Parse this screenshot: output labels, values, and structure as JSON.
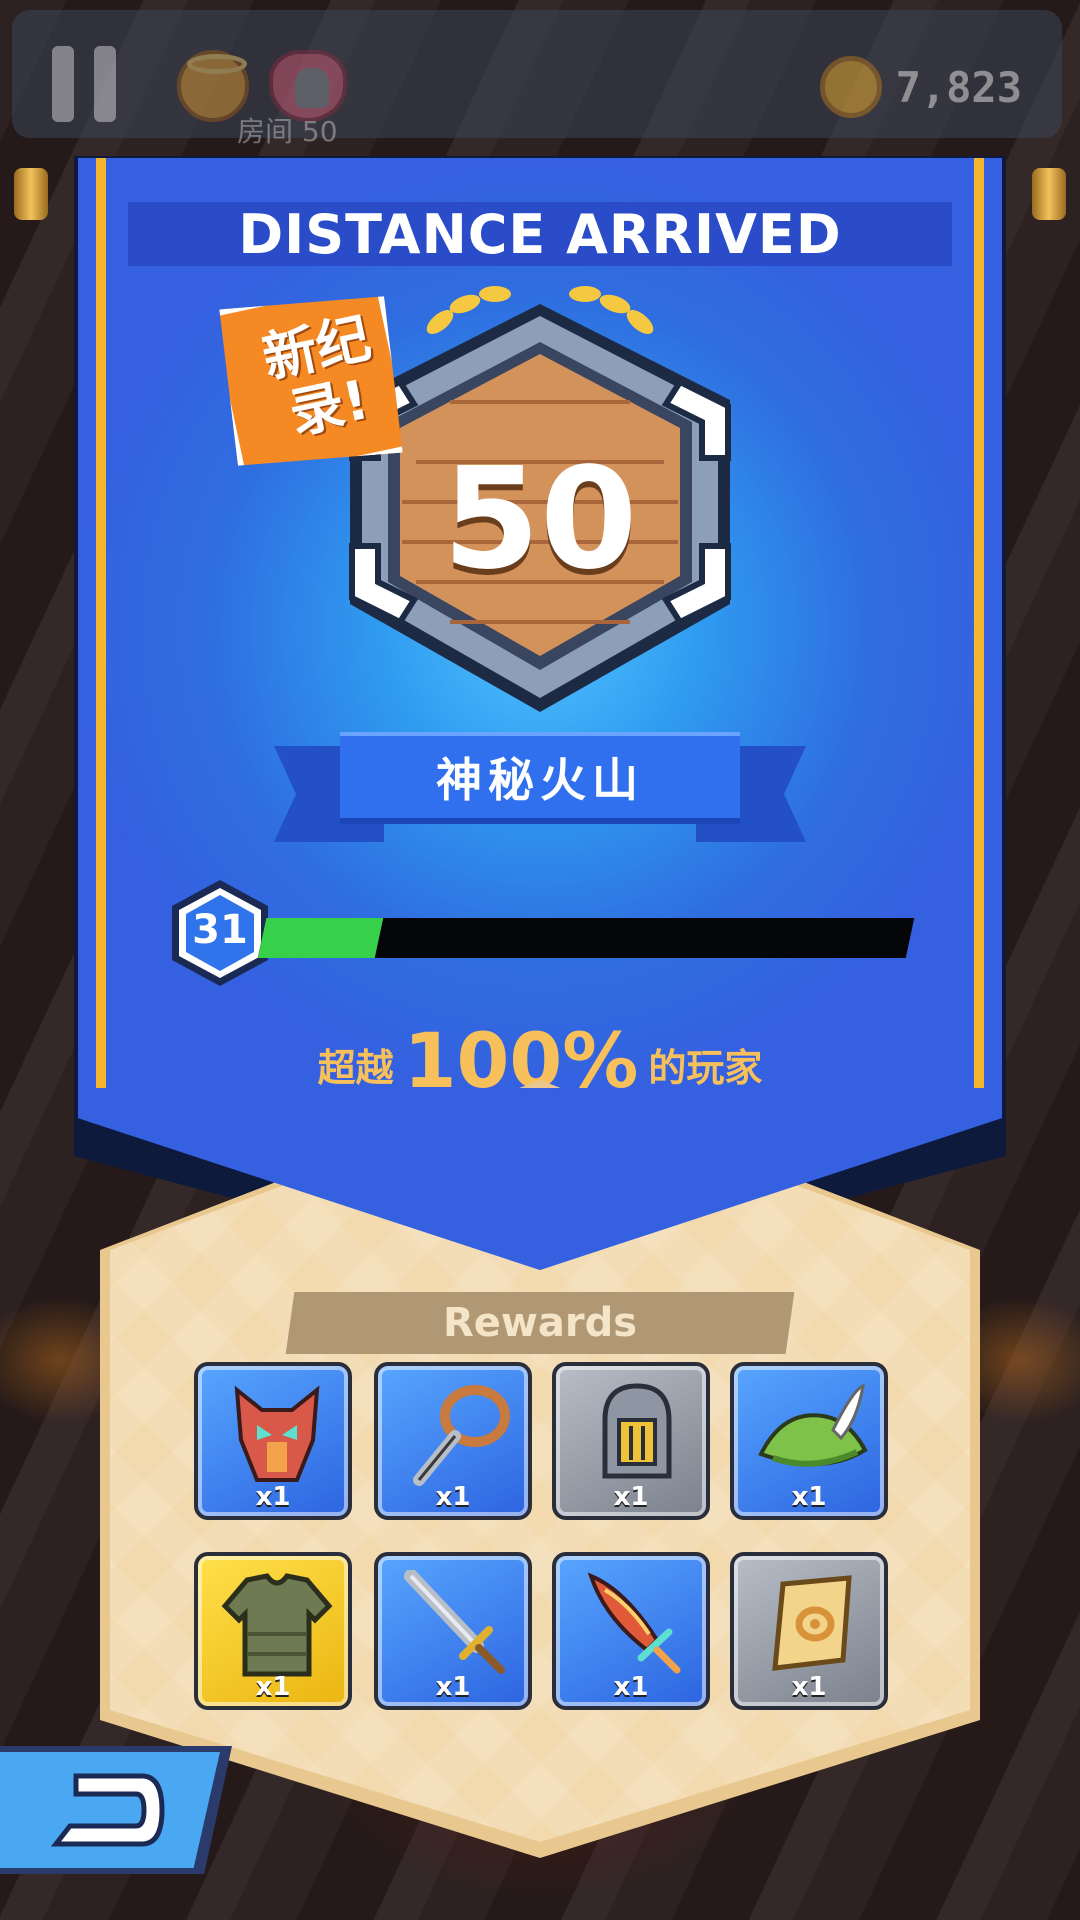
{
  "hud": {
    "party_label": "房间 50",
    "coins": "7,823"
  },
  "banner": {
    "title": "DISTANCE ARRIVED",
    "record_badge": "新纪录!",
    "distance": "50",
    "zone_name": "神秘火山",
    "level": "31",
    "level_progress": 0.18,
    "rank_prefix": "超越",
    "rank_percent": "100%",
    "rank_suffix": "的玩家"
  },
  "rewards": {
    "heading": "Rewards",
    "items": [
      {
        "icon": "dragon-mask-icon",
        "qty": "x1",
        "bg": "blue"
      },
      {
        "icon": "slingshot-icon",
        "qty": "x1",
        "bg": "blue"
      },
      {
        "icon": "knight-helmet-icon",
        "qty": "x1",
        "bg": "gray"
      },
      {
        "icon": "feather-hat-icon",
        "qty": "x1",
        "bg": "blue"
      },
      {
        "icon": "chest-armor-icon",
        "qty": "x1",
        "bg": "gold"
      },
      {
        "icon": "steel-sword-icon",
        "qty": "x1",
        "bg": "blue"
      },
      {
        "icon": "flame-dagger-icon",
        "qty": "x1",
        "bg": "blue"
      },
      {
        "icon": "scroll-icon",
        "qty": "x1",
        "bg": "gray"
      }
    ]
  },
  "colors": {
    "banner_blue": "#3560e0",
    "accent_gold": "#f5b52d",
    "progress_green": "#37d04a",
    "rank_text": "#f7c05a"
  }
}
